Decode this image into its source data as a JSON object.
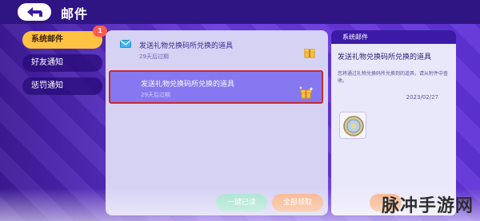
{
  "header": {
    "title": "邮件"
  },
  "sidebar": {
    "items": [
      {
        "label": "系统邮件",
        "badge": "1",
        "active": true
      },
      {
        "label": "好友通知",
        "active": false
      },
      {
        "label": "惩罚通知",
        "active": false
      }
    ]
  },
  "mail_list": {
    "items": [
      {
        "subject": "发送礼物兑换码所兑换的道具",
        "expire": "29天后过期",
        "selected": false
      },
      {
        "subject": "发送礼物兑换码所兑换的道具",
        "expire": "29天后过期",
        "selected": true
      }
    ]
  },
  "detail": {
    "header": "系统邮件",
    "title": "发送礼物兑换码所兑换的道具",
    "body": "您将通过礼物兑换码所兑换到的道具，请从附件中查收。",
    "date": "2023/02/27",
    "attachment_icon": "coin-icon"
  },
  "footer": {
    "read_all_label": "一键已读",
    "claim_all_label": "全部领取",
    "extra_label": "领"
  },
  "watermark": "脉冲手游网",
  "colors": {
    "topbar": "#2f1483",
    "active_tab": "#ffc243",
    "badge": "#ff5a4e",
    "selected_item": "#8578f0",
    "selected_border": "#c92a2a",
    "detail_header": "#3b1aa6",
    "read_button": "#a8e3cf",
    "claim_button": "#f7b58d"
  }
}
